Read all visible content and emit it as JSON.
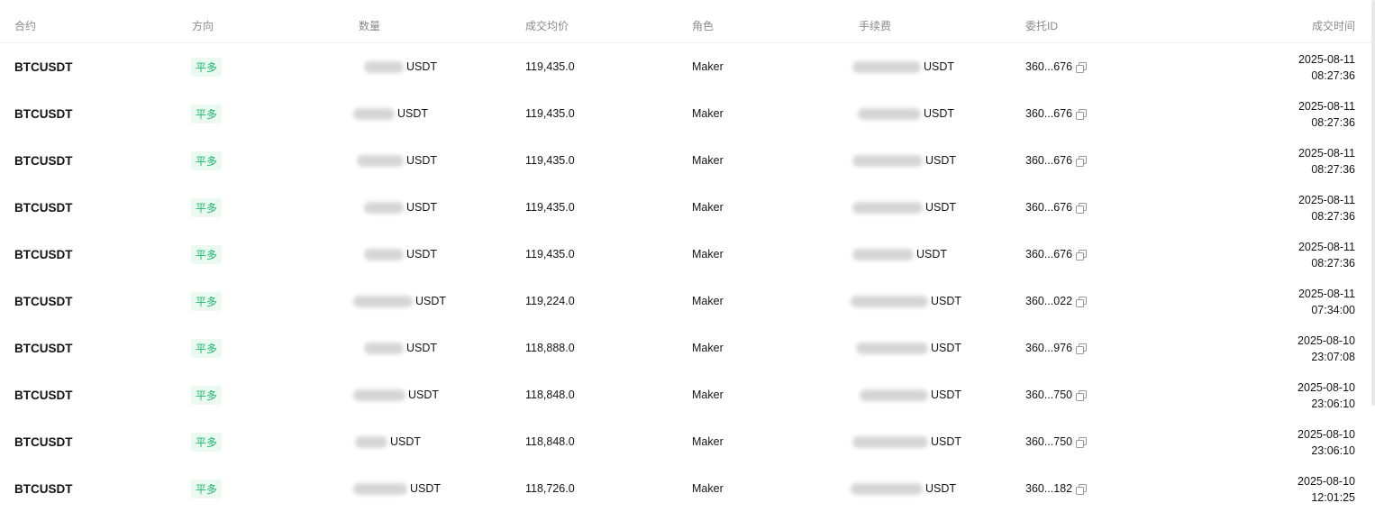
{
  "headers": {
    "symbol": "合约",
    "side": "方向",
    "qty": "数量",
    "price": "成交均价",
    "role": "角色",
    "fee": "手续费",
    "order_id": "委托ID",
    "time": "成交时间"
  },
  "rows": [
    {
      "symbol": "BTCUSDT",
      "side": "平多",
      "qty": "USDT",
      "price": "119,435.0",
      "role": "Maker",
      "fee": "USDT",
      "order_id": "360...676",
      "date": "2025-08-11",
      "time": "08:27:36"
    },
    {
      "symbol": "BTCUSDT",
      "side": "平多",
      "qty": "USDT",
      "price": "119,435.0",
      "role": "Maker",
      "fee": "USDT",
      "order_id": "360...676",
      "date": "2025-08-11",
      "time": "08:27:36"
    },
    {
      "symbol": "BTCUSDT",
      "side": "平多",
      "qty": "USDT",
      "price": "119,435.0",
      "role": "Maker",
      "fee": "USDT",
      "order_id": "360...676",
      "date": "2025-08-11",
      "time": "08:27:36"
    },
    {
      "symbol": "BTCUSDT",
      "side": "平多",
      "qty": "USDT",
      "price": "119,435.0",
      "role": "Maker",
      "fee": "USDT",
      "order_id": "360...676",
      "date": "2025-08-11",
      "time": "08:27:36"
    },
    {
      "symbol": "BTCUSDT",
      "side": "平多",
      "qty": "USDT",
      "price": "119,435.0",
      "role": "Maker",
      "fee": "USDT",
      "order_id": "360...676",
      "date": "2025-08-11",
      "time": "08:27:36"
    },
    {
      "symbol": "BTCUSDT",
      "side": "平多",
      "qty": "USDT",
      "price": "119,224.0",
      "role": "Maker",
      "fee": "USDT",
      "order_id": "360...022",
      "date": "2025-08-11",
      "time": "07:34:00"
    },
    {
      "symbol": "BTCUSDT",
      "side": "平多",
      "qty": "USDT",
      "price": "118,888.0",
      "role": "Maker",
      "fee": "USDT",
      "order_id": "360...976",
      "date": "2025-08-10",
      "time": "23:07:08"
    },
    {
      "symbol": "BTCUSDT",
      "side": "平多",
      "qty": "USDT",
      "price": "118,848.0",
      "role": "Maker",
      "fee": "USDT",
      "order_id": "360...750",
      "date": "2025-08-10",
      "time": "23:06:10"
    },
    {
      "symbol": "BTCUSDT",
      "side": "平多",
      "qty": "USDT",
      "price": "118,848.0",
      "role": "Maker",
      "fee": "USDT",
      "order_id": "360...750",
      "date": "2025-08-10",
      "time": "23:06:10"
    },
    {
      "symbol": "BTCUSDT",
      "side": "平多",
      "qty": "USDT",
      "price": "118,726.0",
      "role": "Maker",
      "fee": "USDT",
      "order_id": "360...182",
      "date": "2025-08-10",
      "time": "12:01:25"
    }
  ]
}
